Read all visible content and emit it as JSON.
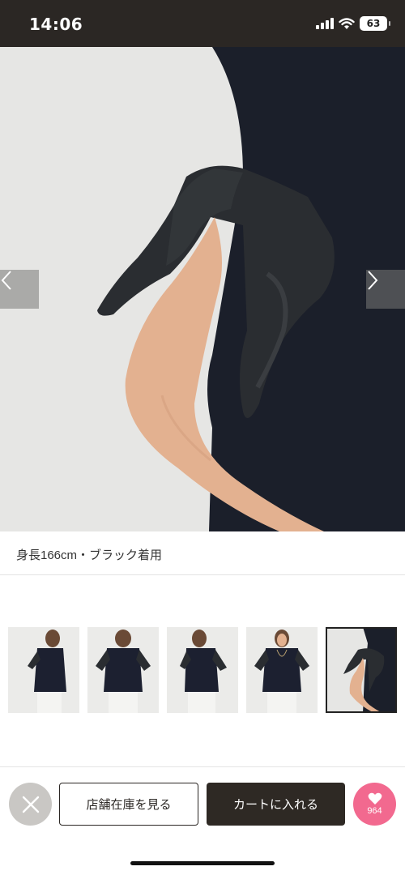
{
  "status_bar": {
    "time": "14:06",
    "battery": "63",
    "icons": [
      "signal-icon",
      "wifi-icon",
      "battery-icon"
    ]
  },
  "gallery": {
    "main_image_alt": "product-photo-sleeve-closeup",
    "prev_icon": "chevron-left-icon",
    "next_icon": "chevron-right-icon",
    "caption": "身長166cm・ブラック着用",
    "thumbnails": [
      {
        "name": "thumbnail-side-view"
      },
      {
        "name": "thumbnail-back-view"
      },
      {
        "name": "thumbnail-side-back-view"
      },
      {
        "name": "thumbnail-front-view"
      },
      {
        "name": "thumbnail-sleeve-closeup",
        "selected": true
      }
    ]
  },
  "bottom_bar": {
    "close_icon": "close-icon",
    "store_stock_label": "店舗在庫を見る",
    "add_to_cart_label": "カートに入れる",
    "favorite_icon": "heart-icon",
    "favorite_count": "964"
  },
  "colors": {
    "status_bar_bg": "#2b2724",
    "cart_button_bg": "#2e2924",
    "favorite_bg": "#f2698f",
    "close_bg": "#c9c7c4"
  }
}
